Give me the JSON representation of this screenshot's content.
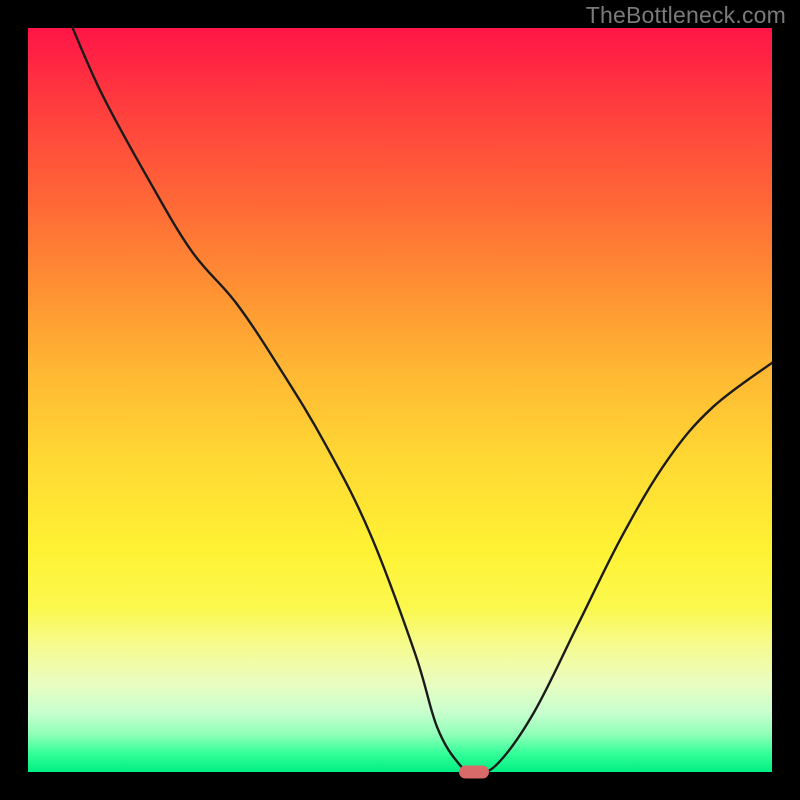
{
  "watermark": "TheBottleneck.com",
  "chart_data": {
    "type": "line",
    "title": "",
    "xlabel": "",
    "ylabel": "",
    "xlim": [
      0,
      100
    ],
    "ylim": [
      0,
      100
    ],
    "background_gradient": {
      "top": "#ff1547",
      "bottom": "#00ef83"
    },
    "marker": {
      "x": 60,
      "y": 0,
      "color": "#d86a6a"
    },
    "series": [
      {
        "name": "bottleneck-curve",
        "x": [
          6,
          10,
          16,
          22,
          28,
          34,
          40,
          46,
          52,
          55,
          58,
          60,
          63,
          68,
          74,
          80,
          86,
          92,
          100
        ],
        "y": [
          100,
          91,
          80,
          70,
          63,
          54,
          44,
          32,
          16,
          6,
          1,
          0,
          1,
          8,
          20,
          32,
          42,
          49,
          55
        ]
      }
    ]
  }
}
